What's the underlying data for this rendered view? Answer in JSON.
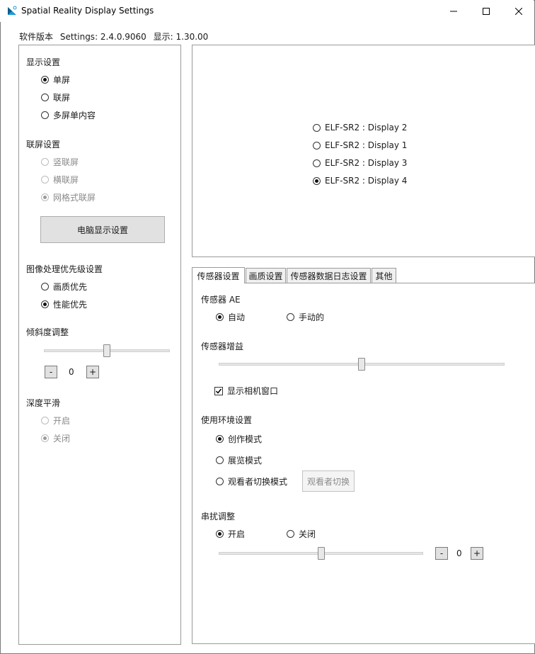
{
  "window": {
    "title": "Spatial Reality Display Settings"
  },
  "version_bar": {
    "label": "软件版本",
    "settings": "Settings: 2.4.0.9060",
    "display": "显示: 1.30.00"
  },
  "left": {
    "display_settings": {
      "label": "显示设置",
      "options": [
        {
          "label": "单屏",
          "checked": true
        },
        {
          "label": "联屏",
          "checked": false
        },
        {
          "label": "多屏单内容",
          "checked": false
        }
      ]
    },
    "tiling_settings": {
      "label": "联屏设置",
      "options": [
        {
          "label": "竖联屏",
          "checked": false
        },
        {
          "label": "横联屏",
          "checked": false
        },
        {
          "label": "网格式联屏",
          "checked": true
        }
      ]
    },
    "pc_display_button": "电脑显示设置",
    "image_priority": {
      "label": "图像处理优先级设置",
      "options": [
        {
          "label": "画质优先",
          "checked": false
        },
        {
          "label": "性能优先",
          "checked": true
        }
      ]
    },
    "tilt": {
      "label": "倾斜度调整",
      "value": "0",
      "minus": "-",
      "plus": "+",
      "fraction": 0.5
    },
    "depth_smoothing": {
      "label": "深度平滑",
      "options": [
        {
          "label": "开启",
          "checked": false
        },
        {
          "label": "关闭",
          "checked": true
        }
      ]
    }
  },
  "displays": [
    {
      "label": "ELF-SR2 : Display 2",
      "checked": false
    },
    {
      "label": "ELF-SR2 : Display 1",
      "checked": false
    },
    {
      "label": "ELF-SR2 : Display 3",
      "checked": false
    },
    {
      "label": "ELF-SR2 : Display 4",
      "checked": true
    }
  ],
  "tabs": [
    {
      "label": "传感器设置",
      "active": true
    },
    {
      "label": "画质设置",
      "active": false
    },
    {
      "label": "传感器数据日志设置",
      "active": false
    },
    {
      "label": "其他",
      "active": false
    }
  ],
  "sensor": {
    "ae": {
      "label": "传感器 AE",
      "options": [
        {
          "label": "自动",
          "checked": true
        },
        {
          "label": "手动的",
          "checked": false
        }
      ]
    },
    "gain": {
      "label": "传感器增益",
      "fraction": 0.5
    },
    "show_camera": {
      "label": "显示相机窗口",
      "checked": true
    },
    "environment": {
      "label": "使用环境设置",
      "options": [
        {
          "label": "创作模式",
          "checked": true
        },
        {
          "label": "展览模式",
          "checked": false
        },
        {
          "label": "观看者切换模式",
          "checked": false
        }
      ],
      "switch_button": "观看者切换"
    },
    "crosstalk": {
      "label": "串扰调整",
      "options": [
        {
          "label": "开启",
          "checked": true
        },
        {
          "label": "关闭",
          "checked": false
        }
      ],
      "value": "0",
      "minus": "-",
      "plus": "+",
      "fraction": 0.5
    }
  }
}
